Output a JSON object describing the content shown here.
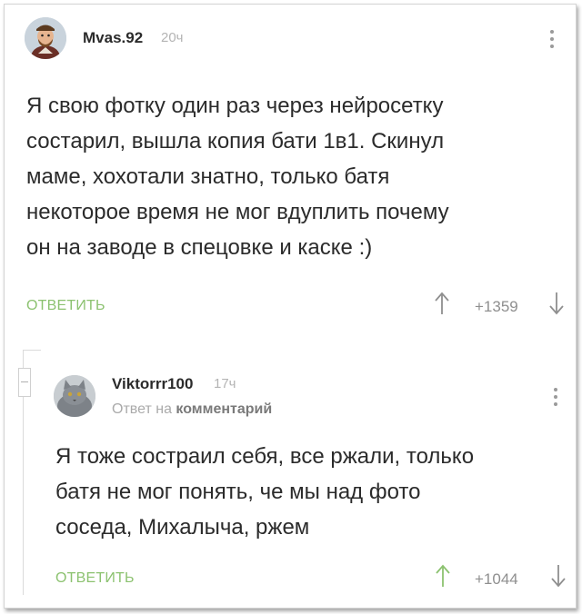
{
  "comment1": {
    "username": "Mvas.92",
    "time": "20ч",
    "text": "Я свою фотку один раз через нейросетку состарил, вышла копия бати 1в1. Скинул маме, хохотали знатно, только батя некоторое время не мог вдуплить почему он на заводе в спецовке и каске :)",
    "lines": [
      "Я свою фотку один раз через нейросетку",
      "состарил, вышла копия бати 1в1. Скинул",
      "маме, хохотали знатно, только батя",
      "некоторое время не мог вдуплить почему",
      "он на заводе в спецовке и каске :)"
    ],
    "reply_label": "ОТВЕТИТЬ",
    "score": "+1359"
  },
  "comment2": {
    "username": "Viktorrr100",
    "time": "17ч",
    "reply_to_prefix": "Ответ на",
    "reply_to_link": "комментарий",
    "lines": [
      "Я тоже состраил себя, все ржали, только",
      "батя не мог понять, че мы над фото",
      "соседа, Михалыча, ржем"
    ],
    "reply_label": "ОТВЕТИТЬ",
    "score": "+1044"
  },
  "colors": {
    "accent_green": "#8cc270",
    "text": "#2b2b2b",
    "muted": "#b4b4b4"
  },
  "icons": {
    "upvote": "arrow-up-icon",
    "downvote": "arrow-down-icon",
    "menu": "more-vertical-icon"
  }
}
